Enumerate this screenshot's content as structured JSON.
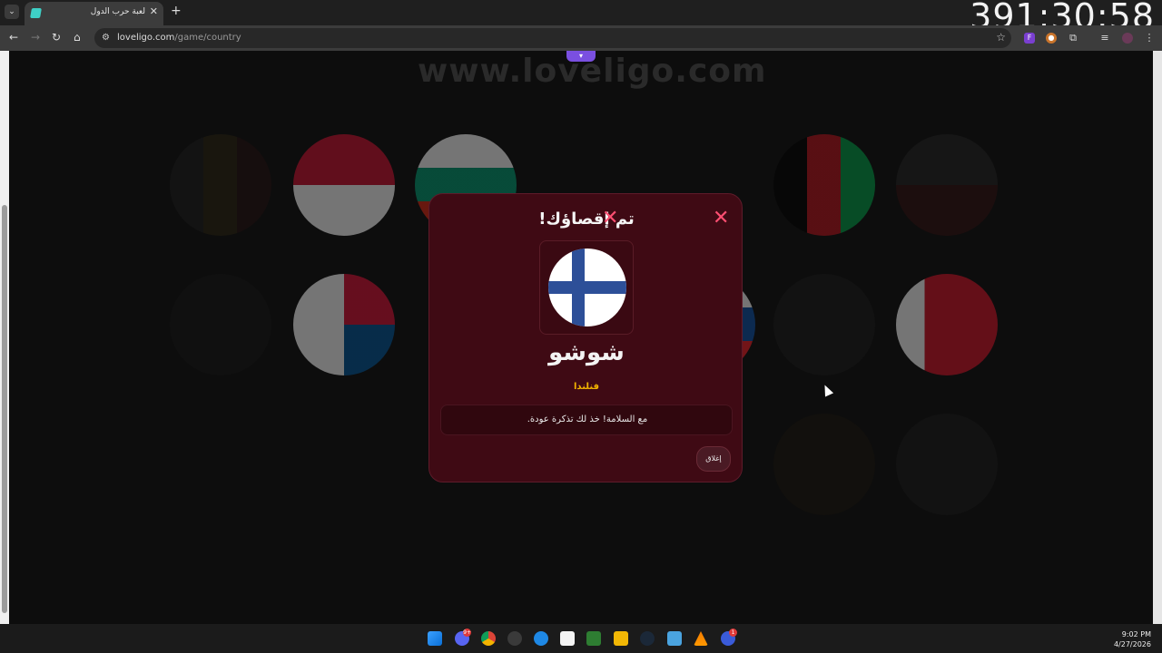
{
  "browser": {
    "tab_title": "لعبة حرب الدول",
    "tab_close": "✕",
    "new_tab": "+",
    "url_domain": "loveligo.com",
    "url_path": "/game/country",
    "clock": "391:30:58"
  },
  "page": {
    "watermark": "www.loveligo.com"
  },
  "modal": {
    "title": "تم إقصاؤك!",
    "close_icon": "✕",
    "player_name": "شوشو",
    "country": "فنلندا",
    "message": "مع السلامة! خذ لك تذكرة عودة.",
    "close_button": "إغلاق"
  },
  "taskbar": {
    "time": "9:02 PM",
    "date": "4/27/2026",
    "badges": [
      "9+",
      "1"
    ]
  },
  "colors": {
    "accent": "#ff4f72",
    "modal_bg": "#3f0a14",
    "country_yellow": "#f2b400",
    "finland_blue": "#2d4f98"
  }
}
